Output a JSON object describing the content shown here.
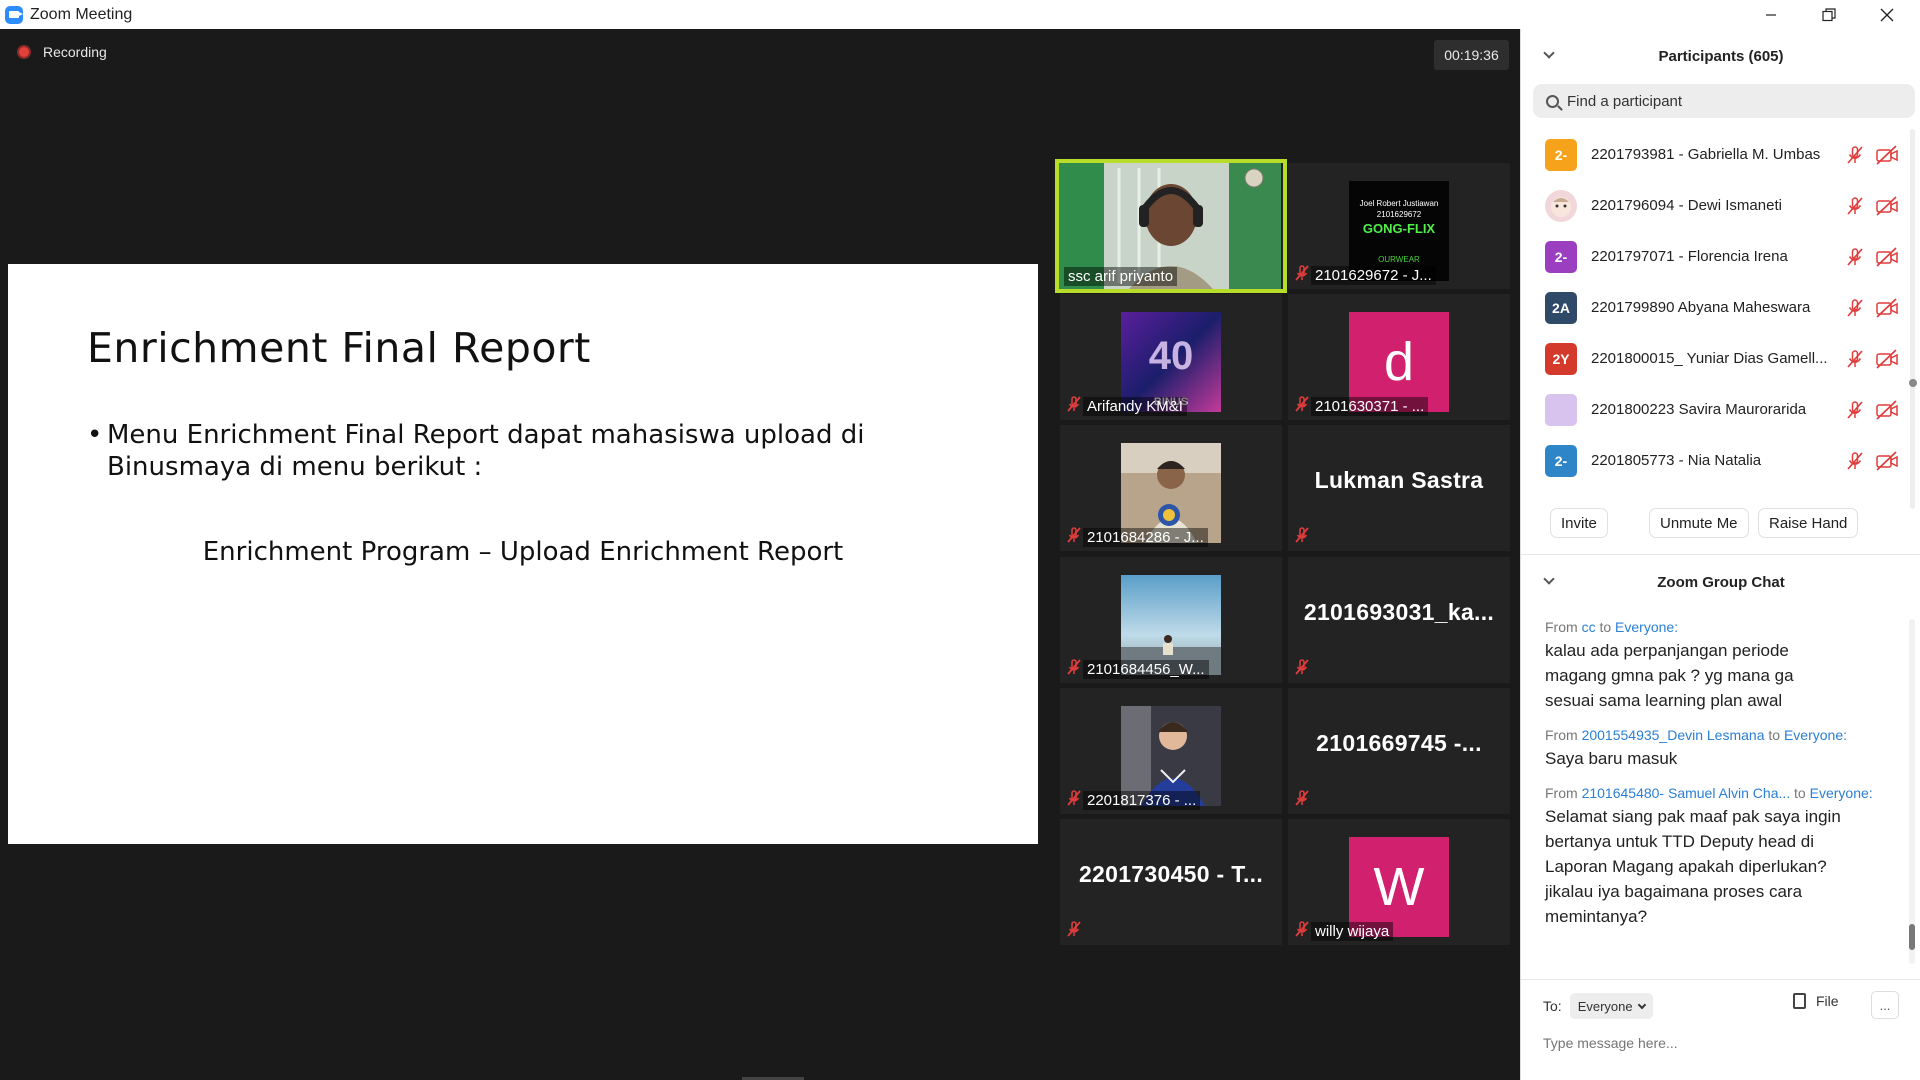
{
  "window": {
    "title": "Zoom Meeting"
  },
  "meeting": {
    "recording_label": "Recording",
    "timer": "00:19:36"
  },
  "slide": {
    "title": "Enrichment Final Report",
    "bullet": "Menu Enrichment Final Report dapat mahasiswa upload di Binusmaya di menu berikut :",
    "subtitle": "Enrichment Program – Upload Enrichment Report"
  },
  "video_tiles": [
    {
      "name": "ssc arif priyanto",
      "kind": "video-person",
      "muted": false,
      "active": true
    },
    {
      "name": "2101629672 - J...",
      "kind": "image-gongflix",
      "muted": true,
      "poster_lines": [
        "Joel Robert Justiawan",
        "2101629672",
        "GONG-FLIX",
        "OURWEAR"
      ]
    },
    {
      "name": "Arifandy KM&I",
      "kind": "image-binus",
      "muted": true,
      "poster_text": "BINUS"
    },
    {
      "name": "2101630371 - ...",
      "kind": "letter",
      "letter": "d",
      "muted": true
    },
    {
      "name": "2101684286 - J...",
      "kind": "image-person2",
      "muted": true
    },
    {
      "name": "",
      "kind": "big-name",
      "big_name": "Lukman Sastra",
      "muted": true
    },
    {
      "name": "2101684456_W...",
      "kind": "image-beach",
      "muted": true
    },
    {
      "name": "",
      "kind": "big-name",
      "big_name": "2101693031_ka...",
      "muted": true
    },
    {
      "name": "2201817376 - ...",
      "kind": "image-person3",
      "muted": true
    },
    {
      "name": "",
      "kind": "big-name",
      "big_name": "2101669745 -...",
      "muted": true
    },
    {
      "name": "",
      "kind": "big-name",
      "big_name": "2201730450 - T...",
      "muted": true
    },
    {
      "name": "willy wijaya",
      "kind": "letter",
      "letter": "W",
      "muted": true
    }
  ],
  "participants_panel": {
    "title": "Participants (605)",
    "search_placeholder": "Find a participant",
    "list": [
      {
        "avatar": "2-",
        "color": "#f7a21b",
        "name": "2201793981 - Gabriella M. Umbas"
      },
      {
        "avatar": "",
        "color": "#f1d7d9",
        "name": "2201796094 - Dewi Ismaneti"
      },
      {
        "avatar": "2-",
        "color": "#9b3fc0",
        "name": "2201797071 - Florencia Irena"
      },
      {
        "avatar": "2A",
        "color": "#2f4a68",
        "name": "2201799890 Abyana Maheswara"
      },
      {
        "avatar": "2Y",
        "color": "#d43a2c",
        "name": "2201800015_ Yuniar Dias Gamell..."
      },
      {
        "avatar": "",
        "color": "#d8c2ee",
        "name": "2201800223 Savira Maurorarida"
      },
      {
        "avatar": "2-",
        "color": "#2e86c8",
        "name": "2201805773 - Nia Natalia"
      }
    ],
    "buttons": {
      "invite": "Invite",
      "unmute": "Unmute Me",
      "raise_hand": "Raise Hand"
    }
  },
  "chat_panel": {
    "title": "Zoom Group Chat",
    "messages": [
      {
        "from_label": "From",
        "sender": "cc",
        "to_label": "to",
        "recipient": "Everyone:",
        "text": "kalau ada perpanjangan periode magang gmna pak ? yg mana ga sesuai sama learning plan awal"
      },
      {
        "from_label": "From",
        "sender": "2001554935_Devin Lesmana",
        "to_label": "to",
        "recipient": "Everyone:",
        "text": "Saya baru masuk"
      },
      {
        "from_label": "From",
        "sender": "2101645480- Samuel Alvin Cha...",
        "to_label": "to",
        "recipient": "Everyone:",
        "text": "Selamat siang pak maaf pak saya ingin bertanya untuk TTD Deputy head di Laporan Magang apakah diperlukan? jikalau iya bagaimana proses cara memintanya?"
      }
    ],
    "to_label": "To:",
    "to_value": "Everyone",
    "file_label": "File",
    "more_label": "...",
    "input_placeholder": "Type message here..."
  }
}
